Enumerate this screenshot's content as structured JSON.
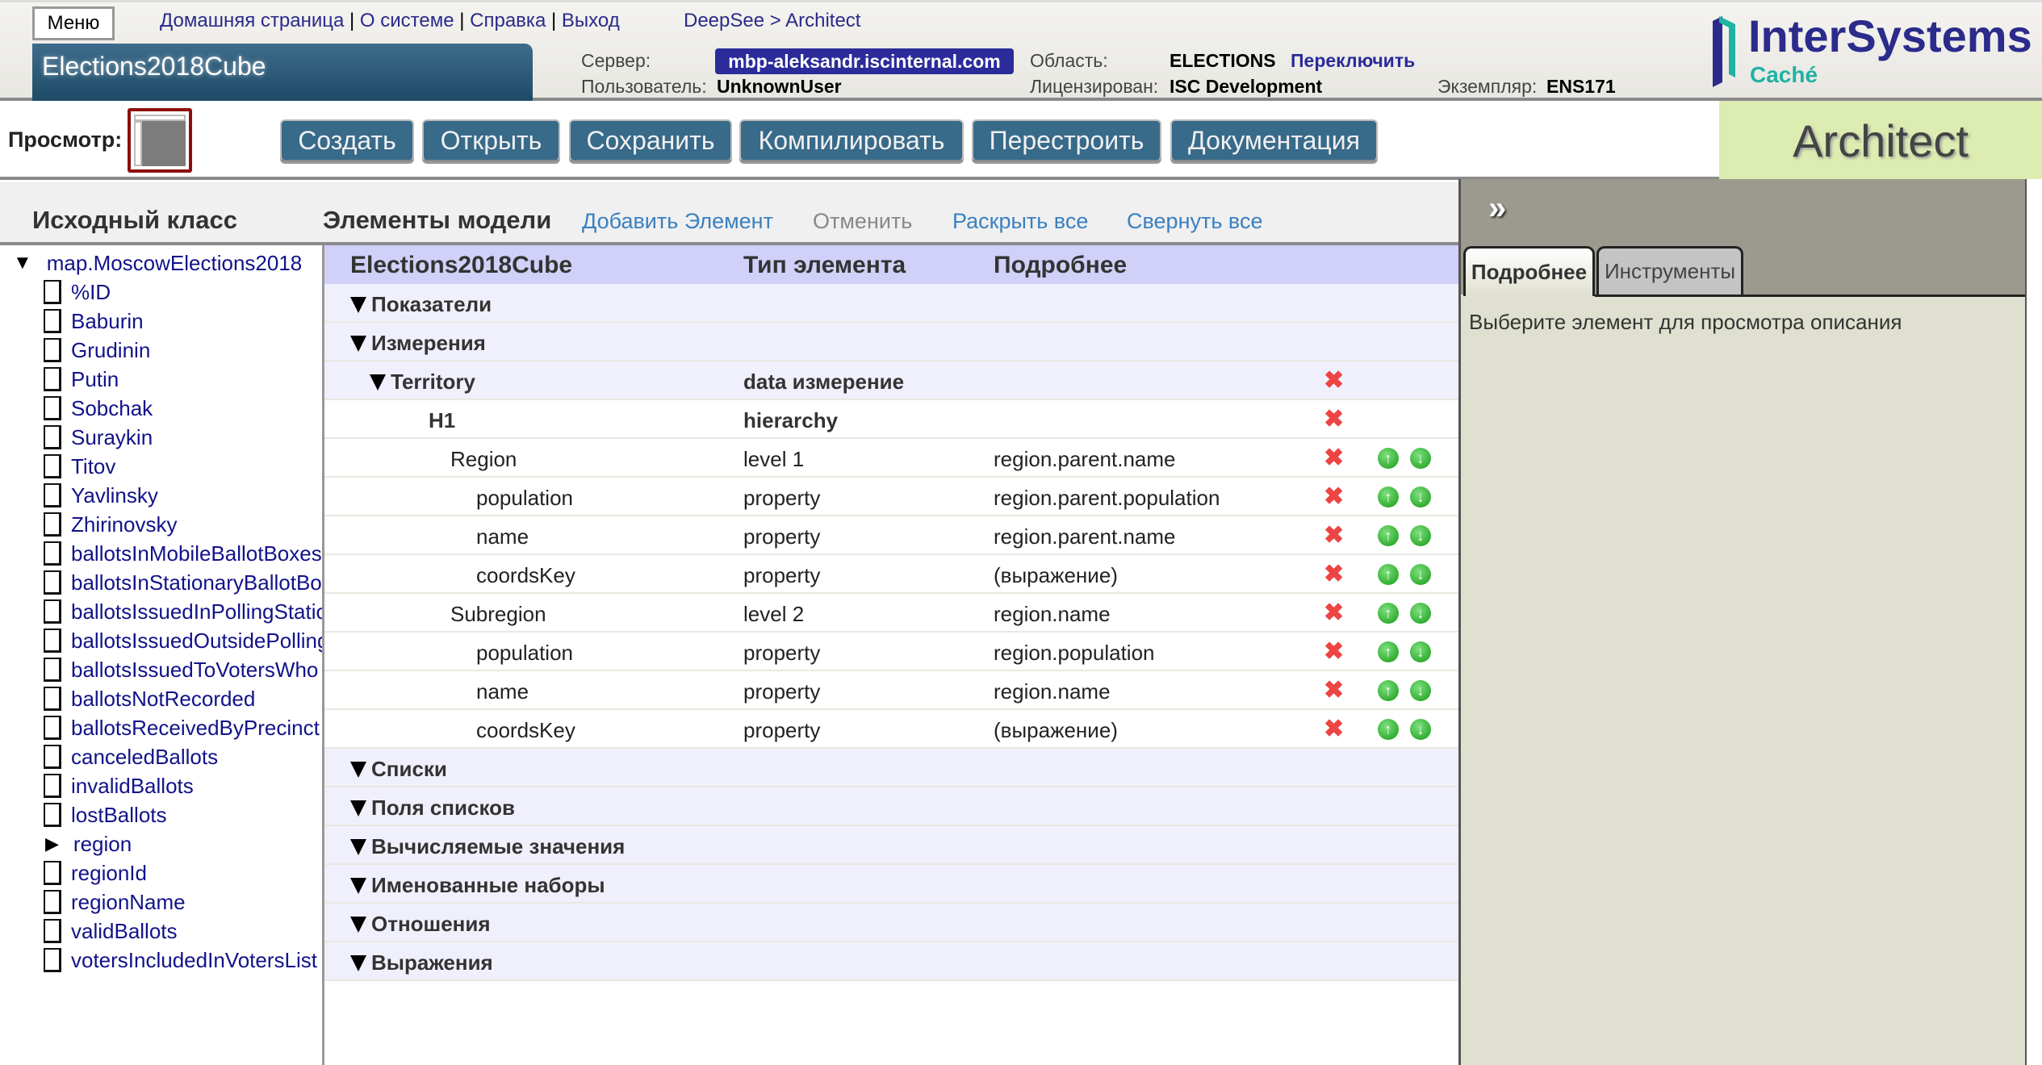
{
  "header": {
    "menu": "Меню",
    "links": [
      "Домашняя страница",
      "О системе",
      "Справка",
      "Выход"
    ],
    "breadcrumb": "DeepSee > Architect",
    "title": "Elections2018Cube",
    "server_label": "Сервер:",
    "server": "mbp-aleksandr.iscinternal.com",
    "user_label": "Пользователь:",
    "user": "UnknownUser",
    "namespace_label": "Область:",
    "namespace": "ELECTIONS",
    "switch": "Переключить",
    "licensed_label": "Лицензирован:",
    "licensed": "ISC Development",
    "instance_label": "Экземпляр:",
    "instance": "ENS171",
    "logo_brand": "InterSystems",
    "logo_product": "Caché"
  },
  "toolbar": {
    "preview_label": "Просмотр:",
    "buttons": [
      "Создать",
      "Открыть",
      "Сохранить",
      "Компилировать",
      "Перестроить",
      "Документация"
    ],
    "app_name": "Architect"
  },
  "sections": {
    "source": "Исходный класс",
    "model": "Элементы модели",
    "add": "Добавить Элемент",
    "undo": "Отменить",
    "expand": "Раскрыть все",
    "collapse": "Свернуть все"
  },
  "tree": {
    "root": "map.MoscowElections2018",
    "items": [
      {
        "label": "%ID"
      },
      {
        "label": "Baburin"
      },
      {
        "label": "Grudinin"
      },
      {
        "label": "Putin"
      },
      {
        "label": "Sobchak"
      },
      {
        "label": "Suraykin"
      },
      {
        "label": "Titov"
      },
      {
        "label": "Yavlinsky"
      },
      {
        "label": "Zhirinovsky"
      },
      {
        "label": "ballotsInMobileBallotBoxes"
      },
      {
        "label": "ballotsInStationaryBallotBoxes"
      },
      {
        "label": "ballotsIssuedInPollingStations"
      },
      {
        "label": "ballotsIssuedOutsidePollingStations"
      },
      {
        "label": "ballotsIssuedToVotersWho"
      },
      {
        "label": "ballotsNotRecorded"
      },
      {
        "label": "ballotsReceivedByPrecinct"
      },
      {
        "label": "canceledBallots"
      },
      {
        "label": "invalidBallots"
      },
      {
        "label": "lostBallots"
      },
      {
        "label": "region",
        "expandable": true
      },
      {
        "label": "regionId"
      },
      {
        "label": "regionName"
      },
      {
        "label": "validBallots"
      },
      {
        "label": "votersIncludedInVotersList"
      }
    ]
  },
  "table": {
    "headers": [
      "Elections2018Cube",
      "Тип элемента",
      "Подробнее"
    ],
    "rows": [
      {
        "name": "Показатели",
        "kind": "category",
        "level": 0
      },
      {
        "name": "Измерения",
        "kind": "category",
        "level": 0
      },
      {
        "name": "Territory",
        "kind": "dimension",
        "level": 1,
        "type": "data измерение",
        "del": true
      },
      {
        "name": "H1",
        "kind": "hierarchy",
        "level": 2,
        "type": "hierarchy",
        "del": true
      },
      {
        "name": "Region",
        "level": 3,
        "type": "level 1",
        "details": "region.parent.name",
        "del": true,
        "move": true
      },
      {
        "name": "population",
        "level": 4,
        "type": "property",
        "details": "region.parent.population",
        "del": true,
        "move": true
      },
      {
        "name": "name",
        "level": 4,
        "type": "property",
        "details": "region.parent.name",
        "del": true,
        "move": true
      },
      {
        "name": "coordsKey",
        "level": 4,
        "type": "property",
        "details": "(выражение)",
        "del": true,
        "move": true
      },
      {
        "name": "Subregion",
        "level": 3,
        "type": "level 2",
        "details": "region.name",
        "del": true,
        "move": true
      },
      {
        "name": "population",
        "level": 4,
        "type": "property",
        "details": "region.population",
        "del": true,
        "move": true
      },
      {
        "name": "name",
        "level": 4,
        "type": "property",
        "details": "region.name",
        "del": true,
        "move": true
      },
      {
        "name": "coordsKey",
        "level": 4,
        "type": "property",
        "details": "(выражение)",
        "del": true,
        "move": true
      },
      {
        "name": "Списки",
        "kind": "category",
        "level": 0
      },
      {
        "name": "Поля списков",
        "kind": "category",
        "level": 0
      },
      {
        "name": "Вычисляемые значения",
        "kind": "category",
        "level": 0
      },
      {
        "name": "Именованные наборы",
        "kind": "category",
        "level": 0
      },
      {
        "name": "Отношения",
        "kind": "category",
        "level": 0
      },
      {
        "name": "Выражения",
        "kind": "category",
        "level": 0
      }
    ]
  },
  "right_panel": {
    "expand_icon": "»",
    "tabs": [
      "Подробнее",
      "Инструменты"
    ],
    "active_tab": 0,
    "message": "Выберите элемент для просмотра описания"
  },
  "colors": {
    "title_bg": "#2d5b78",
    "button_bg": "#386a8a",
    "server_bg": "#2b2b9a",
    "header_row": "#d0d0f8",
    "category_row": "#f0f0fc",
    "architect_bg": "#ddecb0",
    "delete": "#ee4444",
    "move": "#1aa01a"
  }
}
